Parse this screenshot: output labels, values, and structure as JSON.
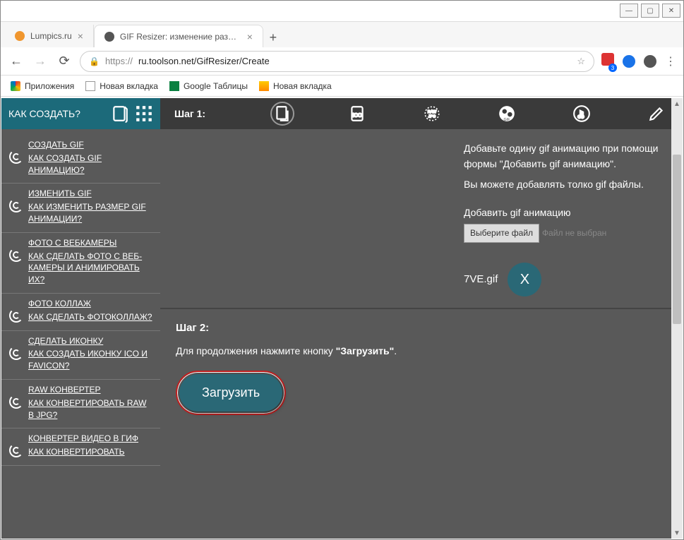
{
  "window": {
    "min": "—",
    "max": "▢",
    "close": "✕"
  },
  "tabs": [
    {
      "label": "Lumpics.ru",
      "favicon": "#f0962e",
      "active": false
    },
    {
      "label": "GIF Resizer: изменение размера",
      "favicon": "#555",
      "active": true
    }
  ],
  "newtab": "+",
  "nav": {
    "back": "←",
    "forward": "→",
    "reload": "⟳"
  },
  "omnibox": {
    "lock": "🔒",
    "url_prefix": "https://",
    "url": "ru.toolson.net/GifResizer/Create",
    "star": "☆"
  },
  "ext": {
    "badge": "3"
  },
  "bookmarks": [
    {
      "icon": "apps",
      "label": "Приложения"
    },
    {
      "icon": "page",
      "label": "Новая вкладка"
    },
    {
      "icon": "sheets",
      "label": "Google Таблицы"
    },
    {
      "icon": "pic",
      "label": "Новая вкладка"
    }
  ],
  "sidebar": {
    "header": "КАК СОЗДАТЬ?",
    "items": [
      {
        "title": "СОЗДАТЬ GIF",
        "sub": "КАК СОЗДАТЬ GIF АНИМАЦИЮ?"
      },
      {
        "title": "ИЗМЕНИТЬ GIF",
        "sub": "КАК ИЗМЕНИТЬ РАЗМЕР GIF АНИМАЦИИ?"
      },
      {
        "title": "ФОТО С ВЕБКАМЕРЫ",
        "sub": "КАК СДЕЛАТЬ ФОТО С ВЕБ-КАМЕРЫ И АНИМИРОВАТЬ ИХ?"
      },
      {
        "title": "ФОТО КОЛЛАЖ",
        "sub": "КАК СДЕЛАТЬ ФОТОКОЛЛАЖ?"
      },
      {
        "title": "СДЕЛАТЬ ИКОНКУ",
        "sub": "КАК СОЗДАТЬ ИКОНКУ ICO И FAVICON?"
      },
      {
        "title": "RAW КОНВЕРТЕР",
        "sub": "КАК КОНВЕРТИРОВАТЬ RAW В JPG?"
      },
      {
        "title": "КОНВЕРТЕР ВИДЕО В ГИФ",
        "sub": "КАК КОНВЕРТИРОВАТЬ"
      }
    ]
  },
  "toolstrip": {
    "step1_label": "Шаг 1:"
  },
  "step1": {
    "instr1": "Добавьте одину gif анимацию при помощи формы \"Добавить gif анимацию\".",
    "instr2": "Вы можете добавлять толко gif файлы.",
    "add_label": "Добавить gif анимацию",
    "choose_btn": "Выберите файл",
    "no_file": "Файл не выбран",
    "filename": "7VE.gif",
    "remove": "X"
  },
  "step2": {
    "title": "Шаг 2:",
    "instr_a": "Для продолжения нажмите кнопку ",
    "instr_b": "\"Загрузить\"",
    "instr_c": ".",
    "button": "Загрузить"
  }
}
